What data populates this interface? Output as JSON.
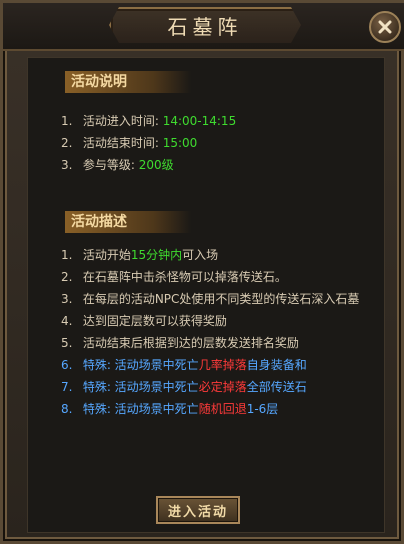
{
  "window": {
    "title": "石墓阵"
  },
  "sections": {
    "description": {
      "title": "活动说明",
      "items": [
        {
          "num": "1.",
          "label": "活动进入时间:",
          "value": "14:00-14:15"
        },
        {
          "num": "2.",
          "label": "活动结束时间:",
          "value": "15:00"
        },
        {
          "num": "3.",
          "label": "参与等级:",
          "value": "200级"
        }
      ]
    },
    "details": {
      "title": "活动描述",
      "items": [
        {
          "num": "1.",
          "parts": [
            "活动开始",
            "15分钟内",
            "可入场"
          ]
        },
        {
          "num": "2.",
          "parts": [
            "在石墓阵中击杀怪物可以掉落传送石。"
          ]
        },
        {
          "num": "3.",
          "parts": [
            "在每层的活动NPC处使用不同类型的传送石深入石墓"
          ]
        },
        {
          "num": "4.",
          "parts": [
            "达到固定层数可以获得奖励"
          ]
        },
        {
          "num": "5.",
          "parts": [
            "活动结束后根据到达的层数发送排名奖励"
          ]
        },
        {
          "num": "6.",
          "parts": [
            "特殊: 活动场景中死亡",
            "几率掉落",
            "自身装备和"
          ]
        },
        {
          "num": "7.",
          "parts": [
            "特殊: 活动场景中死亡",
            "必定掉落",
            "全部传送石"
          ]
        },
        {
          "num": "8.",
          "parts": [
            "特殊: 活动场景中死亡",
            "随机回退",
            "1-6层"
          ]
        }
      ]
    }
  },
  "buttons": {
    "enter": "进入活动"
  },
  "icons": {
    "close": "close-icon"
  },
  "colors": {
    "green": "#3fdb2f",
    "blue": "#56a7ff",
    "red": "#ff3a3a",
    "text": "#d8cbb3"
  }
}
